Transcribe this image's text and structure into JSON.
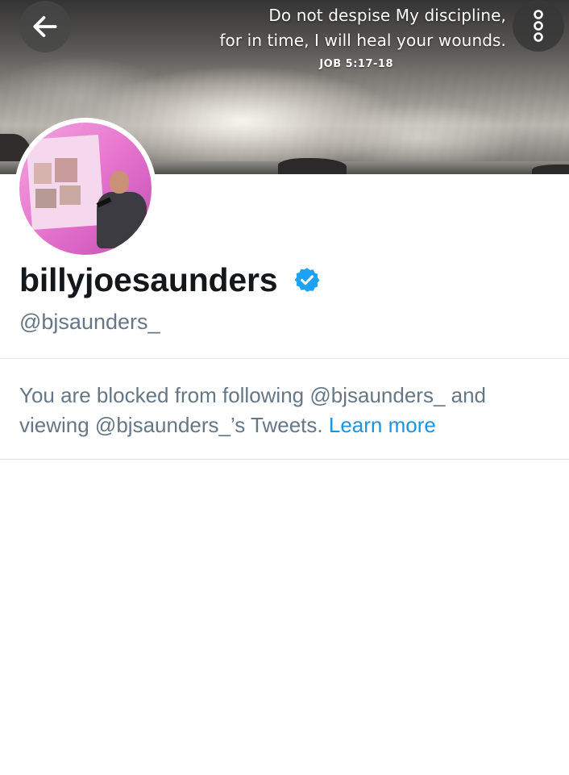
{
  "header": {
    "banner_quote": {
      "line1": "Do not despise My discipline,",
      "line2": "for in time, I will heal your wounds.",
      "reference": "JOB 5:17-18"
    },
    "back_icon": "arrow-left-icon",
    "more_icon": "more-vertical-icon"
  },
  "profile": {
    "display_name": "billyjoesaunders",
    "verified": true,
    "handle": "@bjsaunders_",
    "accent_color": "#1da1f2"
  },
  "notice": {
    "blocked_text": "You are blocked from following @bjsaunders_ and viewing @bjsaunders_’s Tweets.",
    "learn_more": "Learn more",
    "link_color": "#1b95e0"
  }
}
